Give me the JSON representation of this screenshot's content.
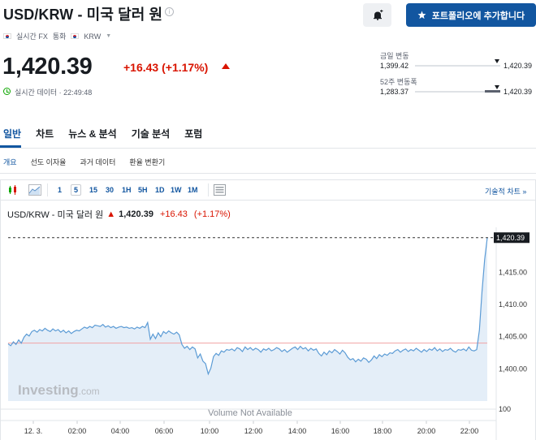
{
  "header": {
    "title": "USD/KRW - 미국 달러 원",
    "info_icon": "i",
    "bell_icon": "bell-plus-icon",
    "portfolio_button": "포트폴리오에 추가합니다",
    "meta": {
      "source": "실시간 FX",
      "currency_label": "통화",
      "currency": "KRW"
    }
  },
  "quote": {
    "price": "1,420.39",
    "change": "+16.43",
    "change_pct": "(+1.17%)",
    "realtime_text": "실시간 데이터 · 22:49:48",
    "colors": {
      "up": "#d91400",
      "accent": "#1256a0"
    }
  },
  "ranges": [
    {
      "label": "금일 변동",
      "low": "1,399.42",
      "high": "1,420.39",
      "position": 0.98
    },
    {
      "label": "52주 변동폭",
      "low": "1,283.37",
      "high": "1,420.39",
      "position": 0.98
    }
  ],
  "tabs": [
    "일반",
    "차트",
    "뉴스 & 분석",
    "기술 분석",
    "포럼"
  ],
  "subtabs": [
    "개요",
    "선도 이자율",
    "과거 데이터",
    "환율 변환기"
  ],
  "toolbar": {
    "intervals": [
      "1",
      "5",
      "15",
      "30",
      "1H",
      "5H",
      "1D",
      "1W",
      "1M"
    ],
    "selected_interval": "5",
    "advanced_link": "기술적 차트 »"
  },
  "chart_legend": {
    "symbol": "USD/KRW - 미국 달러 원",
    "price": "1,420.39",
    "change": "+16.43",
    "change_pct": "(+1.17%)"
  },
  "chart_data": {
    "type": "area",
    "x_ticks": [
      "12. 3.",
      "02:00",
      "04:00",
      "06:00",
      "10:00",
      "12:00",
      "14:00",
      "16:00",
      "18:00",
      "20:00",
      "22:00"
    ],
    "y_ticks": [
      "1,415.00",
      "1,410.00",
      "1,405.00",
      "1,400.00"
    ],
    "volume_tick": "100",
    "current_price_label": "1,420.39",
    "reference_line": 1404,
    "ylim": [
      1395,
      1422
    ],
    "watermark": "Investing",
    "watermark_suffix": ".com",
    "volume_text": "Volume Not Available",
    "series": [
      {
        "values": [
          1403.9,
          1403.6,
          1404.2,
          1403.8,
          1404.5,
          1404.0,
          1404.9,
          1405.4,
          1405.1,
          1405.8,
          1406.0,
          1405.7,
          1406.1,
          1405.9,
          1406.3,
          1406.0,
          1405.8,
          1406.2,
          1405.9,
          1406.1,
          1405.7,
          1406.0,
          1405.6,
          1405.9,
          1405.5,
          1405.8,
          1406.0,
          1405.9,
          1406.2,
          1406.5,
          1406.3,
          1406.6,
          1406.4,
          1406.8,
          1406.7,
          1406.6,
          1406.9,
          1406.5,
          1406.7,
          1406.4,
          1406.6,
          1406.3,
          1406.5,
          1406.6,
          1406.4,
          1406.5,
          1406.3,
          1406.4,
          1406.2,
          1406.5,
          1406.3,
          1406.6,
          1406.4,
          1407.2,
          1404.6,
          1405.4,
          1404.7,
          1405.6,
          1405.0,
          1405.8,
          1405.5,
          1405.9,
          1405.6,
          1405.4,
          1405.7,
          1405.3,
          1403.8,
          1403.2,
          1403.5,
          1403.0,
          1403.4,
          1403.1,
          1401.7,
          1402.3,
          1401.2,
          1400.8,
          1399.2,
          1400.1,
          1401.9,
          1402.4,
          1402.1,
          1402.8,
          1402.6,
          1403.0,
          1402.9,
          1403.1,
          1402.8,
          1403.3,
          1403.1,
          1402.7,
          1403.4,
          1403.0,
          1403.3,
          1402.9,
          1403.2,
          1403.0,
          1402.6,
          1403.1,
          1402.9,
          1403.2,
          1402.8,
          1403.0,
          1403.3,
          1403.1,
          1402.7,
          1403.0,
          1402.6,
          1402.9,
          1403.2,
          1403.4,
          1403.0,
          1403.5,
          1403.1,
          1403.3,
          1402.8,
          1403.2,
          1402.9,
          1403.1,
          1402.4,
          1402.0,
          1402.6,
          1402.2,
          1402.8,
          1402.5,
          1403.0,
          1402.7,
          1402.3,
          1402.9,
          1402.5,
          1401.8,
          1401.4,
          1401.6,
          1401.1,
          1401.5,
          1401.2,
          1401.7,
          1401.5,
          1401.0,
          1401.4,
          1402.0,
          1401.6,
          1402.2,
          1401.9,
          1402.3,
          1402.1,
          1402.5,
          1402.4,
          1402.8,
          1403.0,
          1402.6,
          1402.9,
          1403.1,
          1402.7,
          1403.0,
          1402.8,
          1403.2,
          1402.9,
          1402.6,
          1403.0,
          1402.7,
          1403.1,
          1402.9,
          1403.3,
          1402.8,
          1403.1,
          1402.7,
          1403.0,
          1402.9,
          1403.2,
          1402.8,
          1402.6,
          1403.0,
          1402.9,
          1403.1,
          1402.8,
          1403.4,
          1402.9,
          1402.8,
          1403.0,
          1406.0,
          1412.0,
          1417.0,
          1420.39
        ]
      }
    ]
  }
}
